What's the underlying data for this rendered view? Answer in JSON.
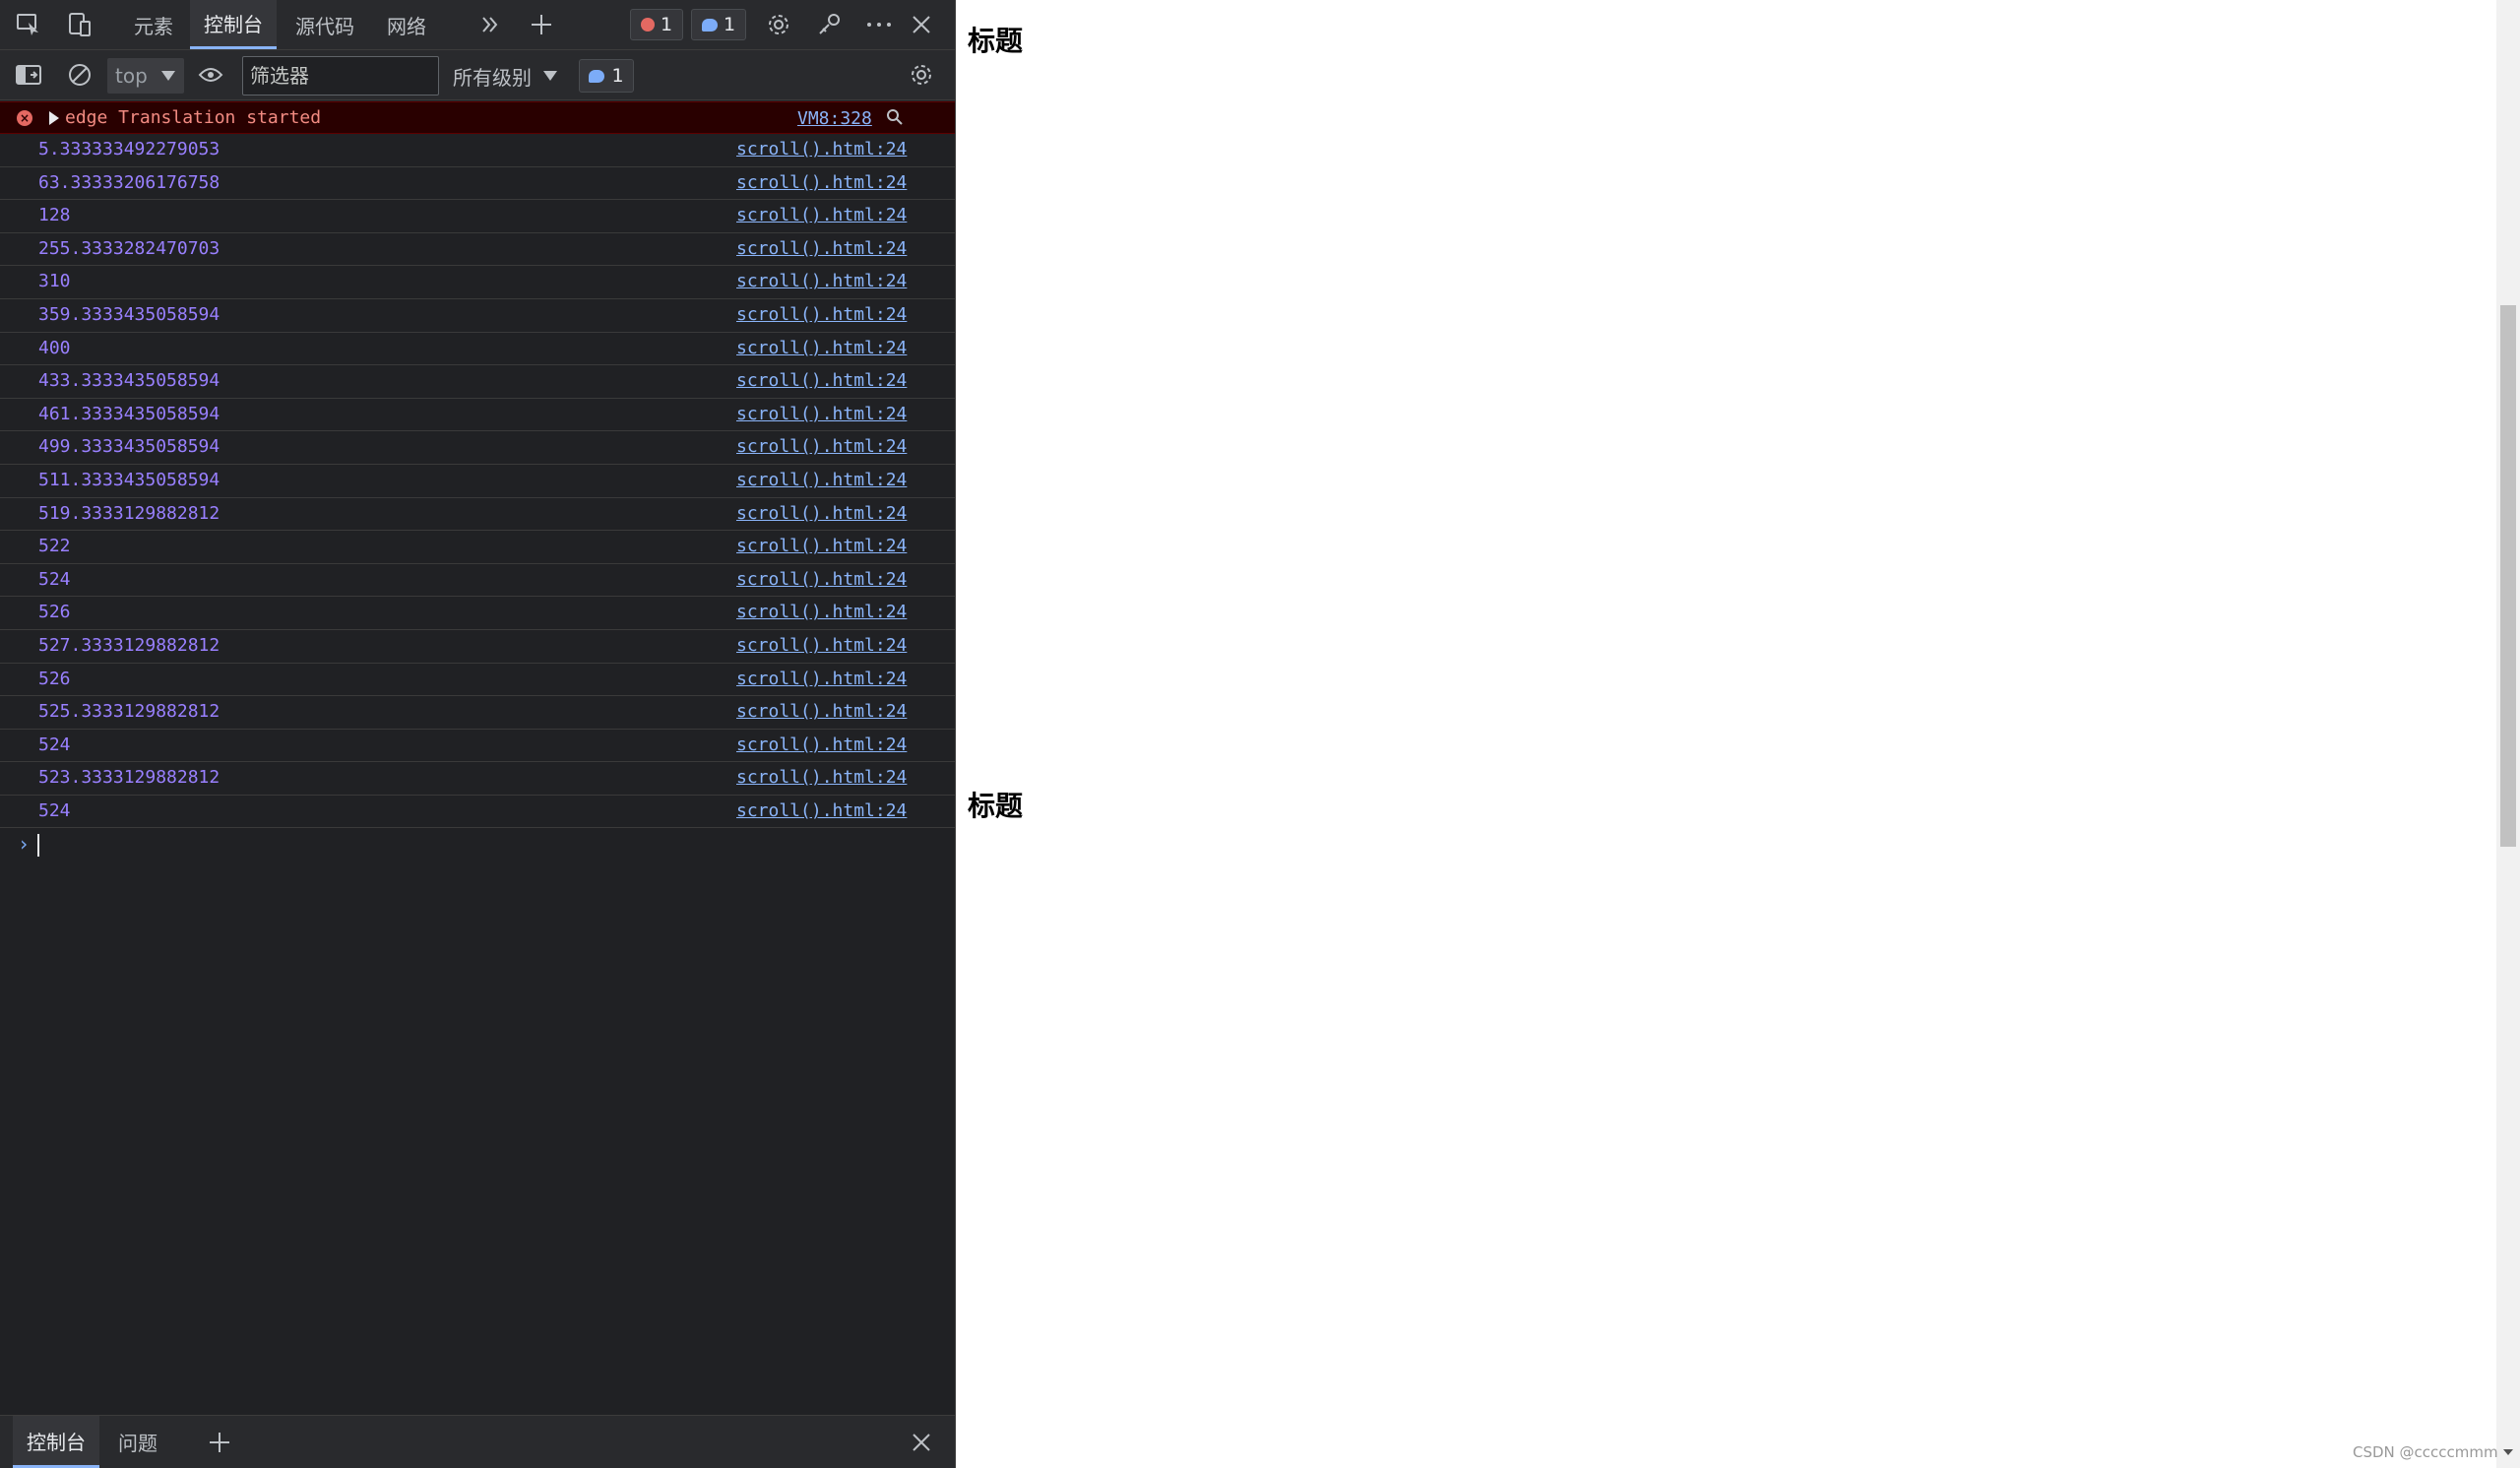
{
  "devtools": {
    "tabs": [
      "元素",
      "控制台",
      "源代码",
      "网络"
    ],
    "active_tab": "控制台",
    "error_count": "1",
    "message_count": "1",
    "toolbar": {
      "context": "top",
      "filter_placeholder": "筛选器",
      "filter_value": "",
      "levels": "所有级别",
      "message_count": "1"
    },
    "error_entry": {
      "text": "edge Translation started",
      "source": "VM8:328"
    },
    "log_entries": [
      {
        "value": "5.333333492279053",
        "source": "scroll().html:24"
      },
      {
        "value": "63.33333206176758",
        "source": "scroll().html:24"
      },
      {
        "value": "128",
        "source": "scroll().html:24"
      },
      {
        "value": "255.3333282470703",
        "source": "scroll().html:24"
      },
      {
        "value": "310",
        "source": "scroll().html:24"
      },
      {
        "value": "359.3333435058594",
        "source": "scroll().html:24"
      },
      {
        "value": "400",
        "source": "scroll().html:24"
      },
      {
        "value": "433.3333435058594",
        "source": "scroll().html:24"
      },
      {
        "value": "461.3333435058594",
        "source": "scroll().html:24"
      },
      {
        "value": "499.3333435058594",
        "source": "scroll().html:24"
      },
      {
        "value": "511.3333435058594",
        "source": "scroll().html:24"
      },
      {
        "value": "519.3333129882812",
        "source": "scroll().html:24"
      },
      {
        "value": "522",
        "source": "scroll().html:24"
      },
      {
        "value": "524",
        "source": "scroll().html:24"
      },
      {
        "value": "526",
        "source": "scroll().html:24"
      },
      {
        "value": "527.3333129882812",
        "source": "scroll().html:24"
      },
      {
        "value": "526",
        "source": "scroll().html:24"
      },
      {
        "value": "525.3333129882812",
        "source": "scroll().html:24"
      },
      {
        "value": "524",
        "source": "scroll().html:24"
      },
      {
        "value": "523.3333129882812",
        "source": "scroll().html:24"
      },
      {
        "value": "524",
        "source": "scroll().html:24"
      }
    ],
    "drawer": {
      "tabs": [
        "控制台",
        "问题"
      ]
    }
  },
  "page": {
    "headings": [
      "标题",
      "标题"
    ],
    "watermark": "CSDN @cccccmmm"
  },
  "colors": {
    "devtools_bg": "#202124",
    "error_bg": "#290000",
    "log_value": "#9980ff",
    "link": "#8ab4f8"
  }
}
